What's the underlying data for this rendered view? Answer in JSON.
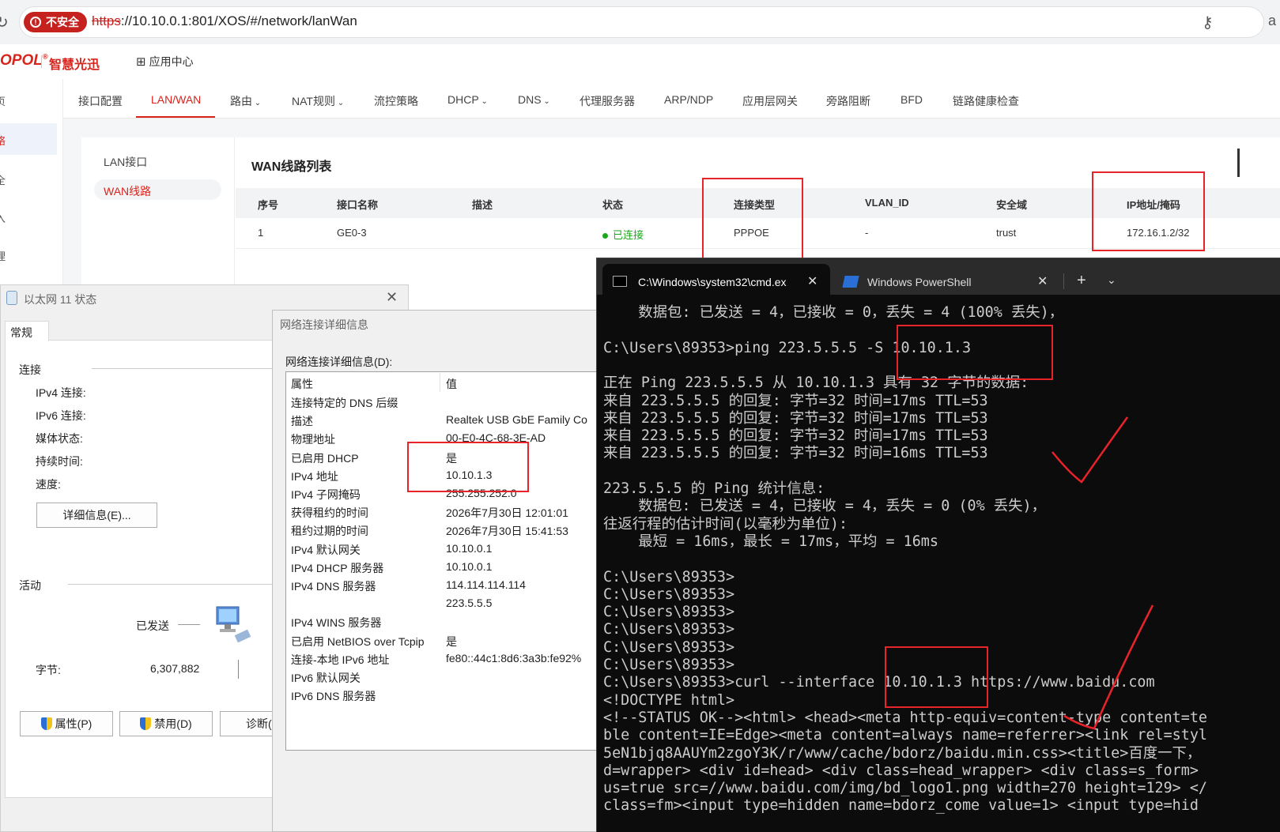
{
  "browser": {
    "insecure_label": "不安全",
    "url_scheme": "https",
    "url_rest": "://10.10.0.1:801/XOS/#/network/lanWan",
    "edge_text": "a"
  },
  "app": {
    "logo": "OPOL",
    "logo_sup": "®",
    "logo_cn": "智慧光迅",
    "app_center": "应用中心",
    "sidebar_chars": [
      "页",
      "络",
      "全",
      "入",
      "理"
    ]
  },
  "tabs": [
    "接口配置",
    "LAN/WAN",
    "路由",
    "NAT规则",
    "流控策略",
    "DHCP",
    "DNS",
    "代理服务器",
    "ARP/NDP",
    "应用层网关",
    "旁路阻断",
    "BFD",
    "链路健康检查"
  ],
  "tab_dropdown_indices": [
    2,
    3,
    5,
    6
  ],
  "active_tab": "LAN/WAN",
  "subnav": {
    "lan": "LAN接口",
    "wan": "WAN线路"
  },
  "wan_table": {
    "title": "WAN线路列表",
    "headers": [
      "序号",
      "接口名称",
      "描述",
      "状态",
      "连接类型",
      "VLAN_ID",
      "安全域",
      "IP地址/掩码"
    ],
    "row": [
      "1",
      "GE0-3",
      "",
      "已连接",
      "PPPOE",
      "-",
      "trust",
      "172.16.1.2/32"
    ]
  },
  "eth_window": {
    "title": "以太网 11 状态",
    "tab": "常规",
    "section_connection": "连接",
    "fields": [
      "IPv4 连接:",
      "IPv6 连接:",
      "媒体状态:",
      "持续时间:",
      "速度:"
    ],
    "details_button": "详细信息(E)...",
    "section_activity": "活动",
    "sent_label": "已发送",
    "bytes_label": "字节:",
    "bytes_value": "6,307,882",
    "buttons": [
      "属性(P)",
      "禁用(D)",
      "诊断("
    ]
  },
  "details_window": {
    "title": "网络连接详细信息",
    "list_label": "网络连接详细信息(D):",
    "col_property": "属性",
    "col_value": "值",
    "rows": [
      {
        "k": "连接特定的 DNS 后缀",
        "v": ""
      },
      {
        "k": "描述",
        "v": "Realtek USB GbE Family Co"
      },
      {
        "k": "物理地址",
        "v": "00-E0-4C-68-3E-AD"
      },
      {
        "k": "已启用 DHCP",
        "v": "是"
      },
      {
        "k": "IPv4 地址",
        "v": "10.10.1.3"
      },
      {
        "k": "IPv4 子网掩码",
        "v": "255.255.252.0"
      },
      {
        "k": "获得租约的时间",
        "v": "2026年7月30日 12:01:01"
      },
      {
        "k": "租约过期的时间",
        "v": "2026年7月30日 15:41:53"
      },
      {
        "k": "IPv4 默认网关",
        "v": "10.10.0.1"
      },
      {
        "k": "IPv4 DHCP 服务器",
        "v": "10.10.0.1"
      },
      {
        "k": "IPv4 DNS 服务器",
        "v": "114.114.114.114"
      },
      {
        "k": "",
        "v": "223.5.5.5"
      },
      {
        "k": "IPv4 WINS 服务器",
        "v": ""
      },
      {
        "k": "已启用 NetBIOS over Tcpip",
        "v": "是"
      },
      {
        "k": "连接-本地 IPv6 地址",
        "v": "fe80::44c1:8d6:3a3b:fe92%"
      },
      {
        "k": "IPv6 默认网关",
        "v": ""
      },
      {
        "k": "IPv6 DNS 服务器",
        "v": ""
      }
    ]
  },
  "terminal": {
    "tab_cmd": "C:\\Windows\\system32\\cmd.ex",
    "tab_ps": "Windows PowerShell",
    "lines": [
      "    数据包: 已发送 = 4，已接收 = 0，丢失 = 4 (100% 丢失)，",
      "",
      "C:\\Users\\89353>ping 223.5.5.5 -S 10.10.1.3",
      "",
      "正在 Ping 223.5.5.5 从 10.10.1.3 具有 32 字节的数据:",
      "来自 223.5.5.5 的回复: 字节=32 时间=17ms TTL=53",
      "来自 223.5.5.5 的回复: 字节=32 时间=17ms TTL=53",
      "来自 223.5.5.5 的回复: 字节=32 时间=17ms TTL=53",
      "来自 223.5.5.5 的回复: 字节=32 时间=16ms TTL=53",
      "",
      "223.5.5.5 的 Ping 统计信息:",
      "    数据包: 已发送 = 4，已接收 = 4，丢失 = 0 (0% 丢失)，",
      "往返行程的估计时间(以毫秒为单位):",
      "    最短 = 16ms，最长 = 17ms，平均 = 16ms",
      "",
      "C:\\Users\\89353>",
      "C:\\Users\\89353>",
      "C:\\Users\\89353>",
      "C:\\Users\\89353>",
      "C:\\Users\\89353>",
      "C:\\Users\\89353>",
      "C:\\Users\\89353>curl --interface 10.10.1.3 https://www.baidu.com",
      "<!DOCTYPE html>",
      "<!--STATUS OK--><html> <head><meta http-equiv=content-type content=te",
      "ble content=IE=Edge><meta content=always name=referrer><link rel=styl",
      "5eN1bjq8AAUYm2zgoY3K/r/www/cache/bdorz/baidu.min.css><title>百度一下，",
      "d=wrapper> <div id=head> <div class=head_wrapper> <div class=s_form> ",
      "us=true src=//www.baidu.com/img/bd_logo1.png width=270 height=129> </",
      "class=fm><input type=hidden name=bdorz_come value=1> <input type=hid"
    ]
  },
  "colors": {
    "brand": "#d9241c",
    "connected": "#1ca61c",
    "annotation": "#e8232a"
  }
}
